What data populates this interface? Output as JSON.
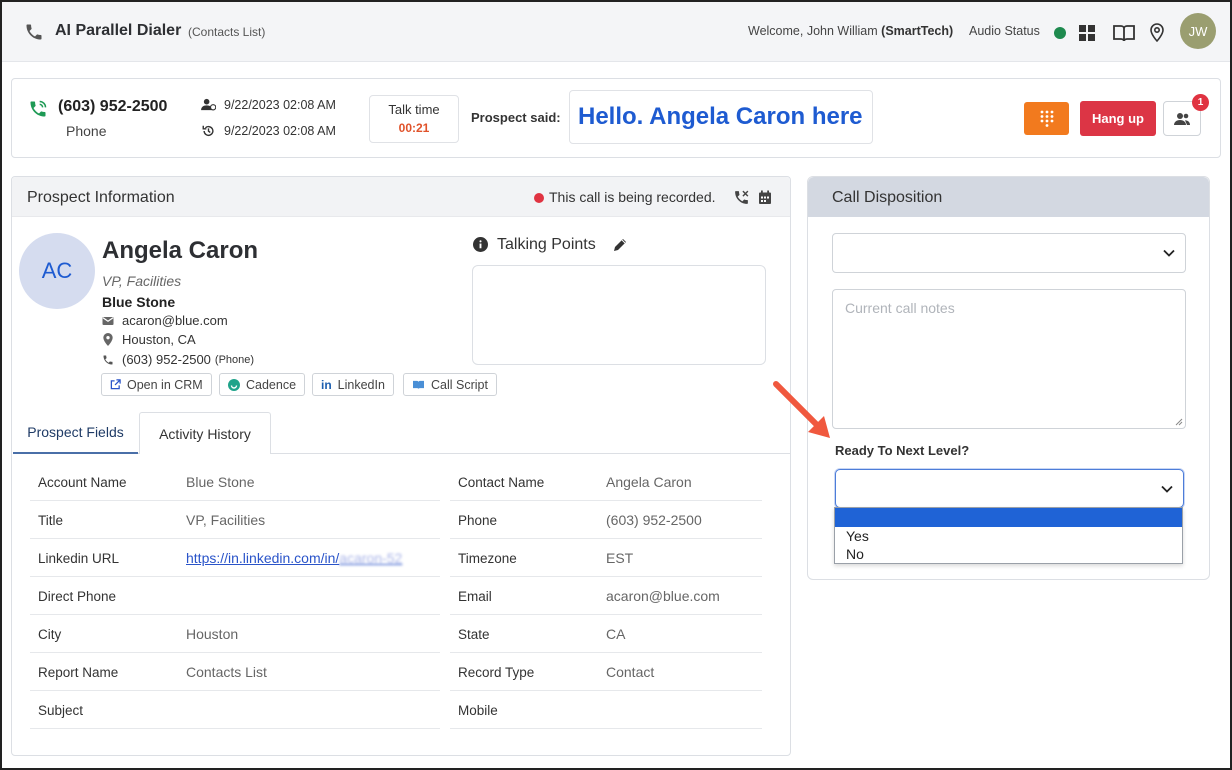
{
  "header": {
    "title": "AI Parallel Dialer",
    "subtitle": "(Contacts List)",
    "welcome_prefix": "Welcome, John William",
    "welcome_org": "(SmartTech)",
    "audio_status_label": "Audio Status",
    "user_initials": "JW",
    "colors": {
      "audio_ok": "#1e8a4f",
      "avatar_bg": "#9a9e70"
    }
  },
  "call_bar": {
    "phone_number": "(603) 952-2500",
    "phone_type": "Phone",
    "started_at": "9/22/2023 02:08 AM",
    "last_at": "9/22/2023 02:08 AM",
    "talk_time_label": "Talk time",
    "talk_time_value": "00:21",
    "prospect_said_label": "Prospect said:",
    "prospect_said_text": "Hello. Angela Caron here",
    "hangup_label": "Hang up",
    "notification_count": "1",
    "colors": {
      "dialpad": "#f27a1e",
      "hangup": "#dc3545",
      "said_text": "#1e5bd1"
    }
  },
  "prospect": {
    "panel_title": "Prospect Information",
    "recording_text": "This call is being recorded.",
    "initials": "AC",
    "name": "Angela Caron",
    "title": "VP, Facilities",
    "company": "Blue Stone",
    "email": "acaron@blue.com",
    "location": "Houston, CA",
    "phone": "(603) 952-2500",
    "phone_type": "(Phone)",
    "actions": {
      "open_crm": "Open in CRM",
      "cadence": "Cadence",
      "linkedin": "LinkedIn",
      "call_script": "Call Script"
    },
    "talking_points_title": "Talking Points",
    "tabs": {
      "fields": "Prospect Fields",
      "history": "Activity History"
    },
    "fields_left": [
      {
        "label": "Account Name",
        "value": "Blue Stone"
      },
      {
        "label": "Title",
        "value": "VP, Facilities"
      },
      {
        "label": "Linkedin URL",
        "value": "https://in.linkedin.com/in/",
        "value_blurred": "acaron-52"
      },
      {
        "label": "Direct Phone",
        "value": ""
      },
      {
        "label": "City",
        "value": "Houston"
      },
      {
        "label": "Report Name",
        "value": "Contacts List"
      },
      {
        "label": "Subject",
        "value": ""
      }
    ],
    "fields_right": [
      {
        "label": "Contact Name",
        "value": "Angela Caron"
      },
      {
        "label": "Phone",
        "value": "(603) 952-2500"
      },
      {
        "label": "Timezone",
        "value": "EST"
      },
      {
        "label": "Email",
        "value": "acaron@blue.com"
      },
      {
        "label": "State",
        "value": "CA"
      },
      {
        "label": "Record Type",
        "value": "Contact"
      },
      {
        "label": "Mobile",
        "value": ""
      }
    ]
  },
  "disposition": {
    "panel_title": "Call Disposition",
    "disposition_selected": "",
    "notes_placeholder": "Current call notes",
    "next_level_label": "Ready To Next Level?",
    "next_level_selected": "",
    "next_level_options": [
      "",
      "Yes",
      "No"
    ],
    "colors": {
      "header": "#d3d8e1",
      "highlight": "#1f63d6",
      "arrow": "#f0583e"
    }
  }
}
